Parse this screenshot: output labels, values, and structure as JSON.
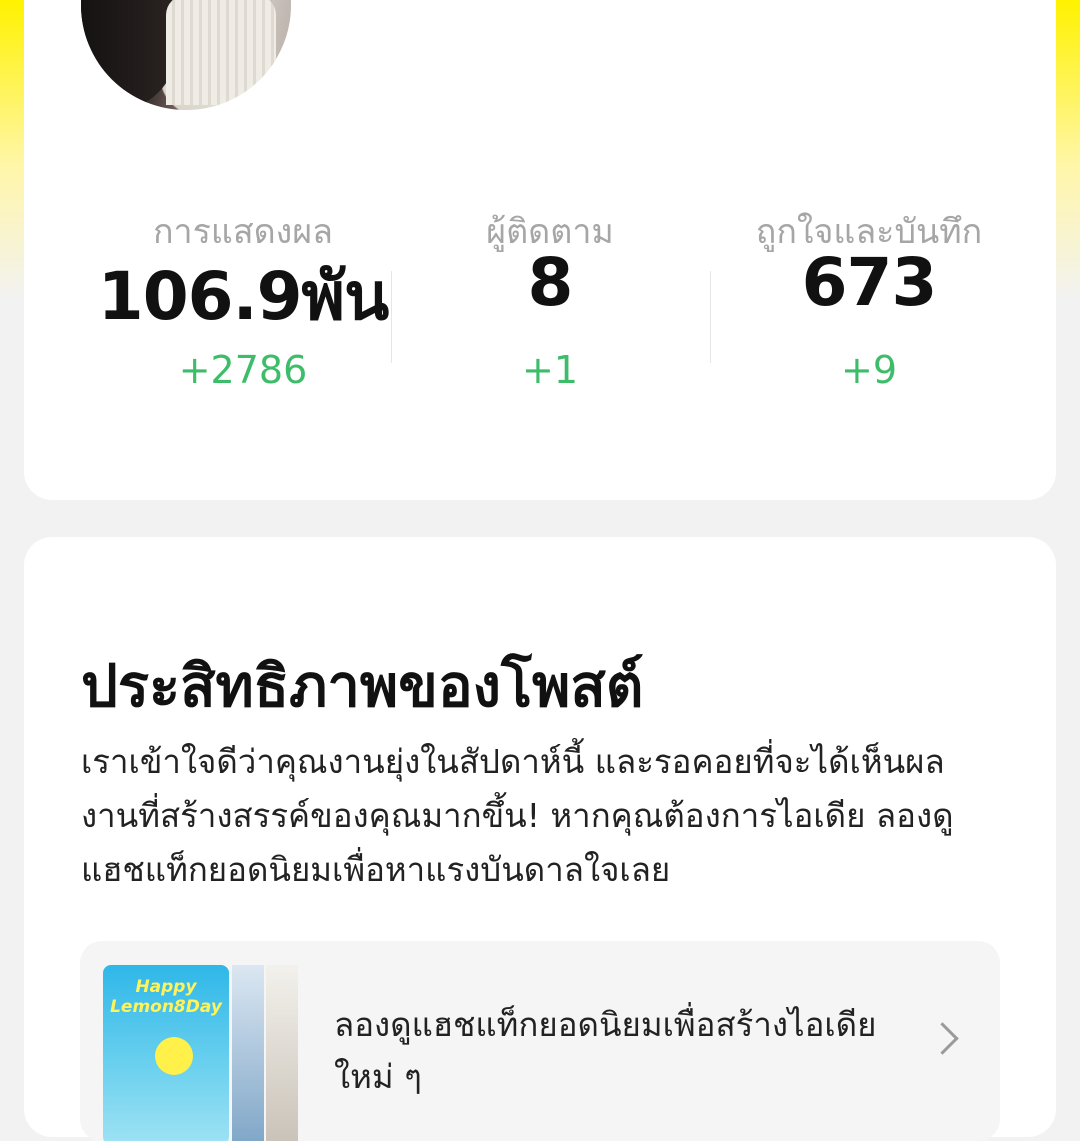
{
  "stats": [
    {
      "label": "การแสดงผล",
      "value": "106.9พัน",
      "delta": "+2786"
    },
    {
      "label": "ผู้ติดตาม",
      "value": "8",
      "delta": "+1"
    },
    {
      "label": "ถูกใจและบันทึก",
      "value": "673",
      "delta": "+9"
    }
  ],
  "performance": {
    "title": "ประสิทธิภาพของโพสต์",
    "description": "เราเข้าใจดีว่าคุณงานยุ่งในสัปดาห์นี้ และรอคอยที่จะได้เห็นผลงานที่สร้างสรรค์ของคุณมากขึ้น! หากคุณต้องการไอเดีย ลองดูแฮชแท็กยอดนิยมเพื่อหาแรงบันดาลใจเลย",
    "hashtag_card": {
      "text": "ลองดูแฮชแท็กยอดนิยมเพื่อสร้างไอเดียใหม่ ๆ",
      "thumb_line1": "Happy",
      "thumb_line2": "Lemon8Day"
    }
  },
  "colors": {
    "accent_yellow": "#fff200",
    "delta_green": "#3dbd6a",
    "label_gray": "#a6a6a6"
  }
}
